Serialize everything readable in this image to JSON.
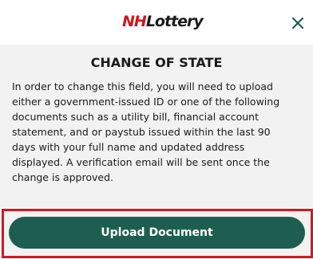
{
  "header": {
    "logo_prefix": "NH",
    "logo_suffix": "Lottery",
    "close_icon": "close-icon"
  },
  "modal": {
    "title": "CHANGE OF STATE",
    "description_lines": [
      "In order to change this field, you will need to upload",
      "either a government-issued ID or one of the following",
      "documents such as a utility bill, financial account",
      "statement, and or paystub issued within the last 90",
      "days with your full name and updated address",
      "displayed. A verification email will be sent once the",
      "change is approved."
    ]
  },
  "actions": {
    "upload_label": "Upload Document"
  },
  "colors": {
    "brand_red": "#d3141c",
    "button_green": "#1e5e50",
    "close_green": "#1e5e50",
    "highlight_red": "#d01920",
    "body_bg": "#f2f2f2"
  }
}
